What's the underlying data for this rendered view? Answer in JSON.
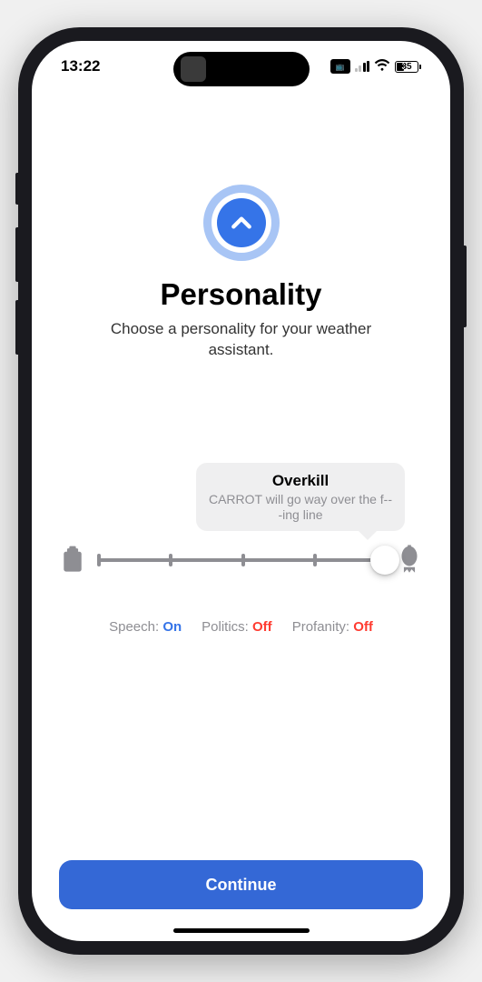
{
  "status": {
    "time": "13:22",
    "battery": "35"
  },
  "header": {
    "title": "Personality",
    "subtitle": "Choose a personality for your weather assistant."
  },
  "slider": {
    "tooltip_title": "Overkill",
    "tooltip_desc": "CARROT will go way over the f---ing line"
  },
  "toggles": {
    "speech_label": "Speech:",
    "speech_value": "On",
    "politics_label": "Politics:",
    "politics_value": "Off",
    "profanity_label": "Profanity:",
    "profanity_value": "Off"
  },
  "cta": {
    "continue": "Continue"
  }
}
